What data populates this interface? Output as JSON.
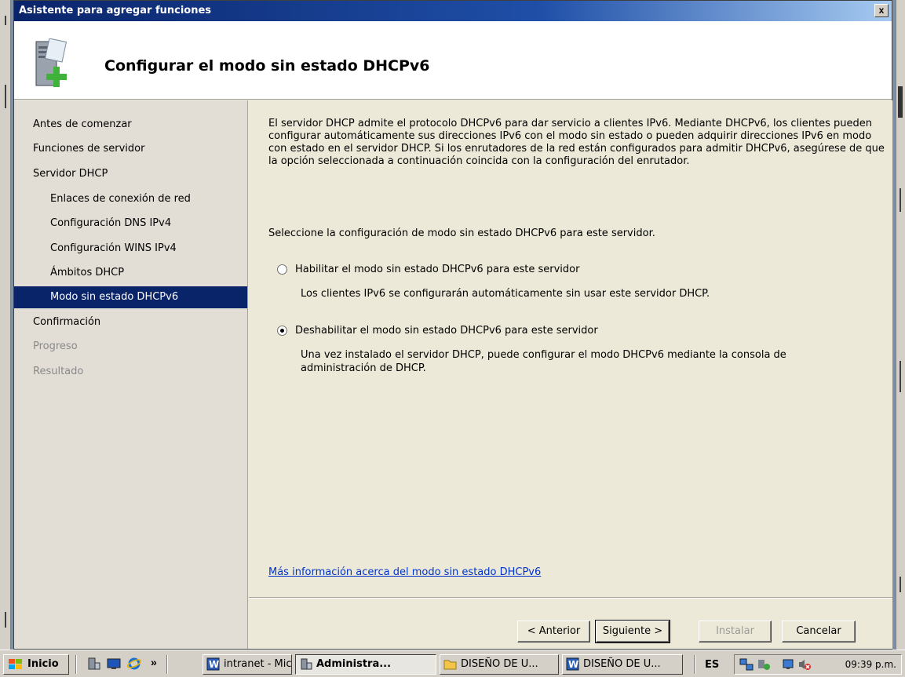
{
  "window": {
    "title": "Asistente para agregar funciones",
    "close_glyph": "x"
  },
  "header": {
    "title": "Configurar el modo sin estado DHCPv6",
    "icon": "server-add-icon"
  },
  "sidebar": {
    "items": [
      {
        "label": "Antes de comenzar",
        "state": "normal",
        "level": 0
      },
      {
        "label": "Funciones de servidor",
        "state": "normal",
        "level": 0
      },
      {
        "label": "Servidor DHCP",
        "state": "normal",
        "level": 0
      },
      {
        "label": "Enlaces de conexión de red",
        "state": "normal",
        "level": 1
      },
      {
        "label": "Configuración DNS IPv4",
        "state": "normal",
        "level": 1
      },
      {
        "label": "Configuración WINS IPv4",
        "state": "normal",
        "level": 1
      },
      {
        "label": "Ámbitos DHCP",
        "state": "normal",
        "level": 1
      },
      {
        "label": "Modo sin estado DHCPv6",
        "state": "active",
        "level": 1
      },
      {
        "label": "Confirmación",
        "state": "normal",
        "level": 0
      },
      {
        "label": "Progreso",
        "state": "disabled",
        "level": 0
      },
      {
        "label": "Resultado",
        "state": "disabled",
        "level": 0
      }
    ]
  },
  "content": {
    "description": "El servidor DHCP admite el protocolo DHCPv6 para dar servicio a clientes IPv6. Mediante DHCPv6, los clientes pueden configurar automáticamente sus direcciones IPv6 con el modo sin estado o pueden adquirir direcciones IPv6 en modo con estado en el servidor DHCP. Si los enrutadores de la red están configurados para admitir DHCPv6, asegúrese de que la opción seleccionada a continuación coincida con la configuración del enrutador.",
    "prompt": "Seleccione la configuración de modo sin estado DHCPv6 para este servidor.",
    "options": [
      {
        "label": "Habilitar el modo sin estado DHCPv6 para este servidor",
        "description": "Los clientes IPv6 se configurarán automáticamente sin usar este servidor DHCP.",
        "checked": false
      },
      {
        "label": "Deshabilitar el modo sin estado DHCPv6 para este servidor",
        "description": "Una vez instalado el servidor DHCP, puede configurar el modo DHCPv6 mediante la consola de administración de DHCP.",
        "checked": true
      }
    ],
    "link": "Más información acerca del modo sin estado DHCPv6"
  },
  "buttons": {
    "back": "< Anterior",
    "next": "Siguiente >",
    "install": "Instalar",
    "cancel": "Cancelar"
  },
  "taskbar": {
    "start": "Inicio",
    "overflow": "»",
    "tasks": [
      {
        "label": "intranet - Mic...",
        "icon": "word-icon",
        "pressed": false
      },
      {
        "label": "Administra...",
        "icon": "server-manager-icon",
        "pressed": true
      },
      {
        "label": "DISEÑO DE U...",
        "icon": "folder-icon",
        "pressed": false
      },
      {
        "label": "DISEÑO DE U...",
        "icon": "word-icon",
        "pressed": false
      }
    ],
    "language": "ES",
    "clock": "09:39 p.m."
  }
}
